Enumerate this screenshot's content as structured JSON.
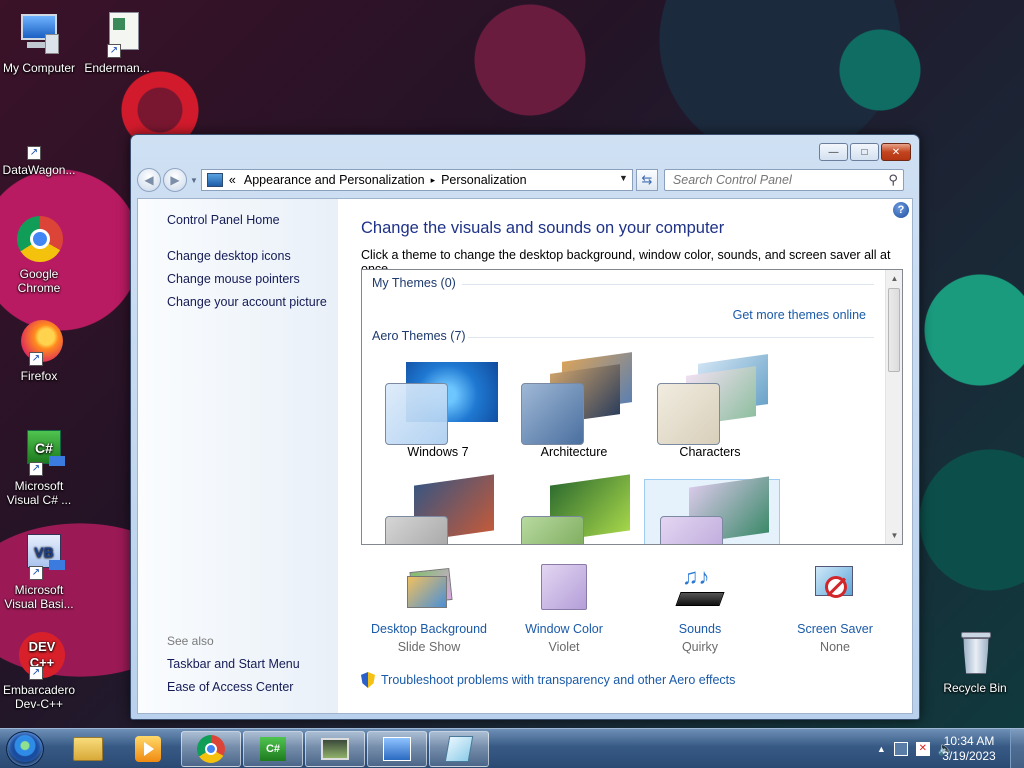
{
  "desktop": {
    "icons": [
      {
        "label": "My Computer"
      },
      {
        "label": "Enderman..."
      },
      {
        "label": "DataWagon..."
      },
      {
        "label": "Google Chrome"
      },
      {
        "label": "Firefox"
      },
      {
        "label": "Microsoft Visual C# ..."
      },
      {
        "label": "Microsoft Visual Basi..."
      },
      {
        "label": "Embarcadero Dev-C++"
      },
      {
        "label": "Recycle Bin"
      }
    ]
  },
  "window": {
    "buttons": {
      "minimize": "—",
      "maximize": "□",
      "close": "✕"
    },
    "address": {
      "prefix": "«",
      "crumbs": [
        "Appearance and Personalization",
        "Personalization"
      ],
      "separator": "▸"
    },
    "search": {
      "placeholder": "Search Control Panel"
    },
    "left_pane": {
      "home": "Control Panel Home",
      "links": [
        "Change desktop icons",
        "Change mouse pointers",
        "Change your account picture"
      ],
      "see_also_label": "See also",
      "see_also": [
        "Taskbar and Start Menu",
        "Ease of Access Center"
      ]
    },
    "main": {
      "help": "?",
      "title": "Change the visuals and sounds on your computer",
      "description": "Click a theme to change the desktop background, window color, sounds, and screen saver all at once.",
      "my_themes_header": "My Themes (0)",
      "get_more": "Get more themes online",
      "aero_header": "Aero Themes (7)",
      "themes": [
        "Windows 7",
        "Architecture",
        "Characters"
      ],
      "bottom": [
        {
          "label": "Desktop Background",
          "value": "Slide Show"
        },
        {
          "label": "Window Color",
          "value": "Violet"
        },
        {
          "label": "Sounds",
          "value": "Quirky"
        },
        {
          "label": "Screen Saver",
          "value": "None"
        }
      ],
      "troubleshoot": "Troubleshoot problems with transparency and other Aero effects"
    }
  },
  "taskbar": {
    "time": "10:34 AM",
    "date": "3/19/2023",
    "tray_up": "▲"
  }
}
